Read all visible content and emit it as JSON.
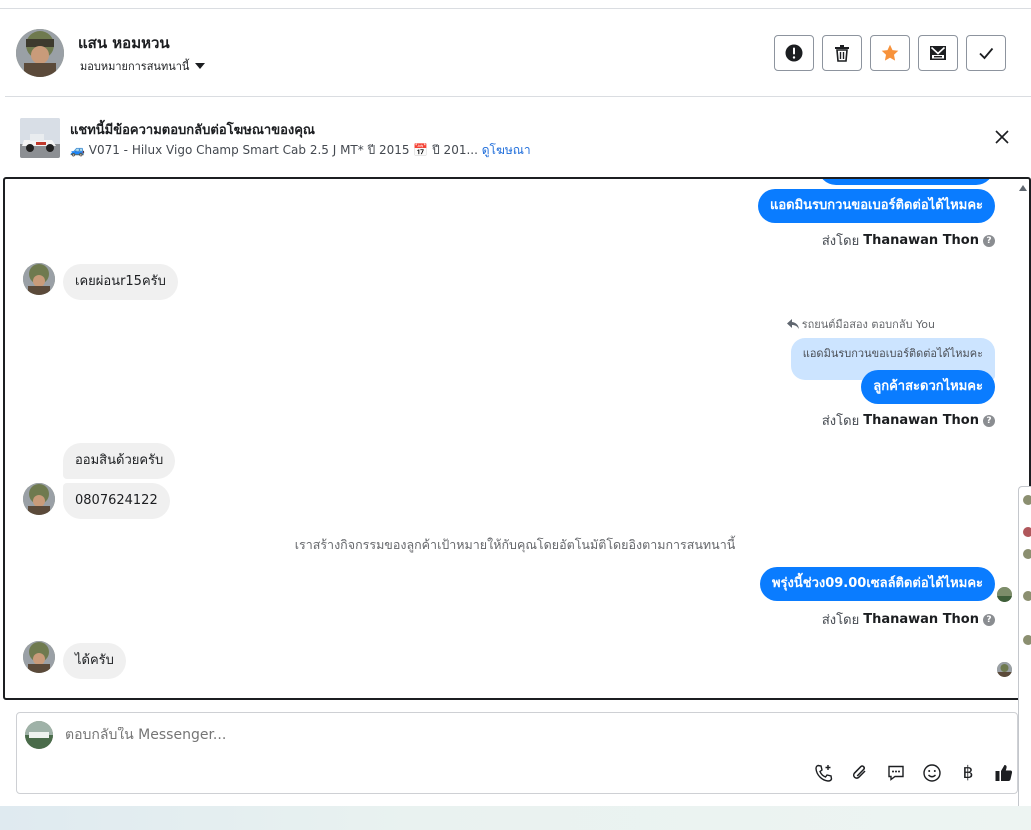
{
  "header": {
    "contact_name": "แสน หอมหวน",
    "assign_label": "มอบหมายการสนทนานี้",
    "actions": [
      {
        "name": "report-button",
        "icon": "alert-icon"
      },
      {
        "name": "delete-button",
        "icon": "trash-icon"
      },
      {
        "name": "star-button",
        "icon": "star-icon"
      },
      {
        "name": "mark-unread-button",
        "icon": "mail-icon"
      },
      {
        "name": "done-button",
        "icon": "check-icon"
      }
    ]
  },
  "ad": {
    "title": "แชทนี้มีข้อความตอบกลับต่อโฆษณาของคุณ",
    "subtitle": "🚙 V071 - Hilux Vigo Champ Smart Cab 2.5 J MT* ปี 2015 📅 ปี 201...",
    "link": "ดูโฆษณา"
  },
  "chat": {
    "messages": {
      "out1": "แอดมินรบกวนขอเบอร์ติดต่อได้ไหมคะ",
      "sent_by_prefix": "ส่งโดย",
      "sender": "Thanawan Thon",
      "in1": "เคยผ่อนr15ครับ",
      "reply_meta": "รถยนต์มือสอง ตอบกลับ You",
      "quoted": "แอดมินรบกวนขอเบอร์ติดต่อได้ไหมคะ",
      "out2": "ลูกค้าสะดวกไหมคะ",
      "in2": "ออมสินด้วยครับ",
      "in3": "0807624122",
      "system_note": "เราสร้างกิจกรรมของลูกค้าเป้าหมายให้กับคุณโดยอัตโนมัติโดยอิงตามการสนทนานี้",
      "out3": "พรุ่งนี้ช่วง09.00เซลล์ติดต่อได้ไหมคะ",
      "in4": "ได้ครับ"
    }
  },
  "composer": {
    "placeholder": "ตอบกลับใน Messenger...",
    "baht": "฿",
    "tools": [
      "call-add-icon",
      "attach-icon",
      "quick-reply-icon",
      "emoji-icon",
      "baht-icon",
      "like-icon"
    ]
  },
  "colors": {
    "accent": "#0a7cff",
    "incoming": "#f0f0f0",
    "quoted": "#cce4ff",
    "star": "#f7923b"
  }
}
